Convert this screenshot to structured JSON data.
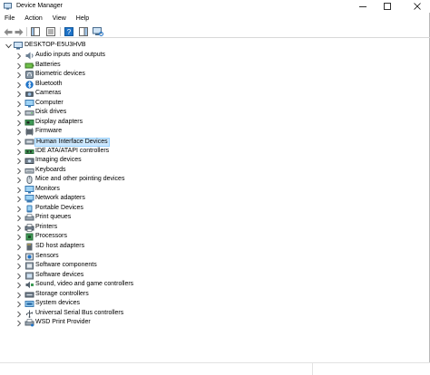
{
  "window": {
    "title": "Device Manager"
  },
  "menu": [
    "File",
    "Action",
    "View",
    "Help"
  ],
  "tree": {
    "root_label": "DESKTOP-E5U3HVB",
    "items": [
      {
        "label": "Audio inputs and outputs",
        "icon": "speaker-icon"
      },
      {
        "label": "Batteries",
        "icon": "battery-icon"
      },
      {
        "label": "Biometric devices",
        "icon": "fingerprint-icon"
      },
      {
        "label": "Bluetooth",
        "icon": "bluetooth-icon"
      },
      {
        "label": "Cameras",
        "icon": "camera-icon"
      },
      {
        "label": "Computer",
        "icon": "monitor-icon"
      },
      {
        "label": "Disk drives",
        "icon": "disk-drive-icon"
      },
      {
        "label": "Display adapters",
        "icon": "display-adapter-icon"
      },
      {
        "label": "Firmware",
        "icon": "firmware-icon"
      },
      {
        "label": "Human Interface Devices",
        "icon": "hid-icon"
      },
      {
        "label": "IDE ATA/ATAPI controllers",
        "icon": "ide-controller-icon"
      },
      {
        "label": "Imaging devices",
        "icon": "imaging-device-icon"
      },
      {
        "label": "Keyboards",
        "icon": "keyboard-icon"
      },
      {
        "label": "Mice and other pointing devices",
        "icon": "mouse-icon"
      },
      {
        "label": "Monitors",
        "icon": "monitor-icon"
      },
      {
        "label": "Network adapters",
        "icon": "network-adapter-icon"
      },
      {
        "label": "Portable Devices",
        "icon": "portable-device-icon"
      },
      {
        "label": "Print queues",
        "icon": "print-queue-icon"
      },
      {
        "label": "Printers",
        "icon": "printer-icon"
      },
      {
        "label": "Processors",
        "icon": "processor-icon"
      },
      {
        "label": "SD host adapters",
        "icon": "sd-card-icon"
      },
      {
        "label": "Sensors",
        "icon": "sensor-icon"
      },
      {
        "label": "Software components",
        "icon": "software-component-icon"
      },
      {
        "label": "Software devices",
        "icon": "software-device-icon"
      },
      {
        "label": "Sound, video and game controllers",
        "icon": "sound-controller-icon"
      },
      {
        "label": "Storage controllers",
        "icon": "storage-controller-icon"
      },
      {
        "label": "System devices",
        "icon": "system-device-icon"
      },
      {
        "label": "Universal Serial Bus controllers",
        "icon": "usb-icon"
      },
      {
        "label": "WSD Print Provider",
        "icon": "wsd-print-icon"
      }
    ],
    "selected_index": 9
  },
  "colors": {
    "selection_bg": "#cce8ff",
    "selection_border": "#99d1ff",
    "accent": "#1e73c8"
  }
}
